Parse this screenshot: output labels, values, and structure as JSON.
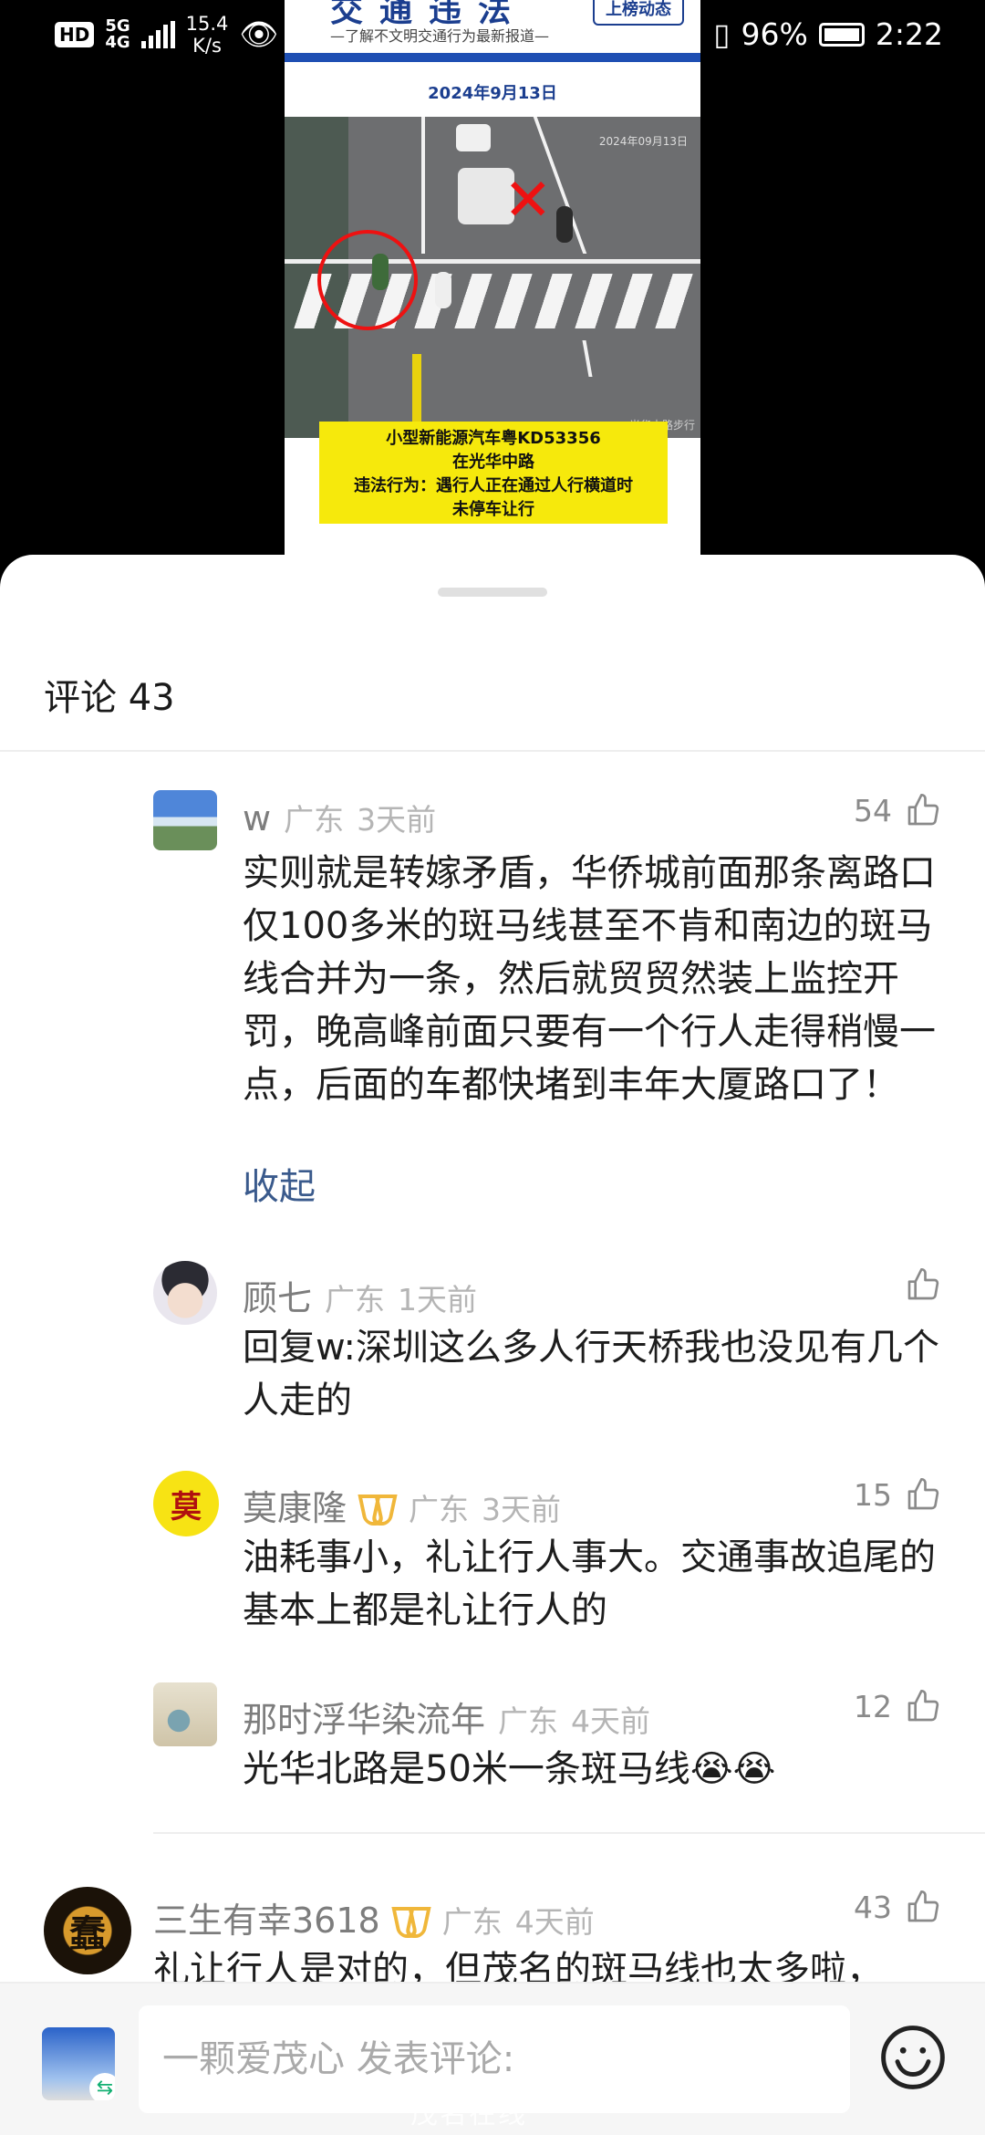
{
  "status_bar": {
    "hd": "HD",
    "network": "5G",
    "network_sub": "4G",
    "speed_value": "15.4",
    "speed_unit": "K/s",
    "battery": "96%",
    "time": "2:22"
  },
  "post_image": {
    "title": "交通违法",
    "subtitle": "—了解不文明交通行为最新报道—",
    "badge": "上榜动态",
    "date": "2024年9月13日",
    "camera_date": "2024年09月13日",
    "camera_location": "光华中路步行",
    "caption_lines": [
      "小型新能源汽车粤KD53356",
      "在光华中路",
      "违法行为：遇行人正在通过人行横道时",
      "未停车让行"
    ]
  },
  "comments_panel": {
    "title": "评论 43",
    "comments": [
      {
        "name": "w",
        "location": "广东",
        "time": "3天前",
        "likes": "54",
        "text": "实则就是转嫁矛盾，华侨城前面那条离路口仅100多米的斑马线甚至不肯和南边的斑马线合并为一条，然后就贸贸然装上监控开罚，晚高峰前面只要有一个行人走得稍慢一点，后面的车都快堵到丰年大厦路口了！",
        "collapse_label": "收起"
      },
      {
        "name": "顾七",
        "location": "广东",
        "time": "1天前",
        "likes": "",
        "text": "回复w:深圳这么多人行天桥我也没见有几个人走的"
      },
      {
        "name": "莫康隆",
        "location": "广东",
        "time": "3天前",
        "likes": "15",
        "text": "油耗事小，礼让行人事大。交通事故追尾的基本上都是礼让行人的",
        "avatar_char": "莫"
      },
      {
        "name": "那时浮华染流年",
        "location": "广东",
        "time": "4天前",
        "likes": "12",
        "text": "光华北路是50米一条斑马线😭😭"
      },
      {
        "name": "三生有幸3618",
        "location": "广东",
        "time": "4天前",
        "likes": "43",
        "text": "礼让行人是对的，但茂名的斑马线也太多啦，",
        "avatar_char": "蠢"
      }
    ]
  },
  "input_bar": {
    "placeholder": "一颗爱茂心 发表评论:"
  },
  "watermark": "茂名在线",
  "colors": {
    "accent_blue": "#1b3e8f",
    "caption_yellow": "#f6e90c",
    "link": "#3a5a8c",
    "medal": "#f0b73a"
  }
}
